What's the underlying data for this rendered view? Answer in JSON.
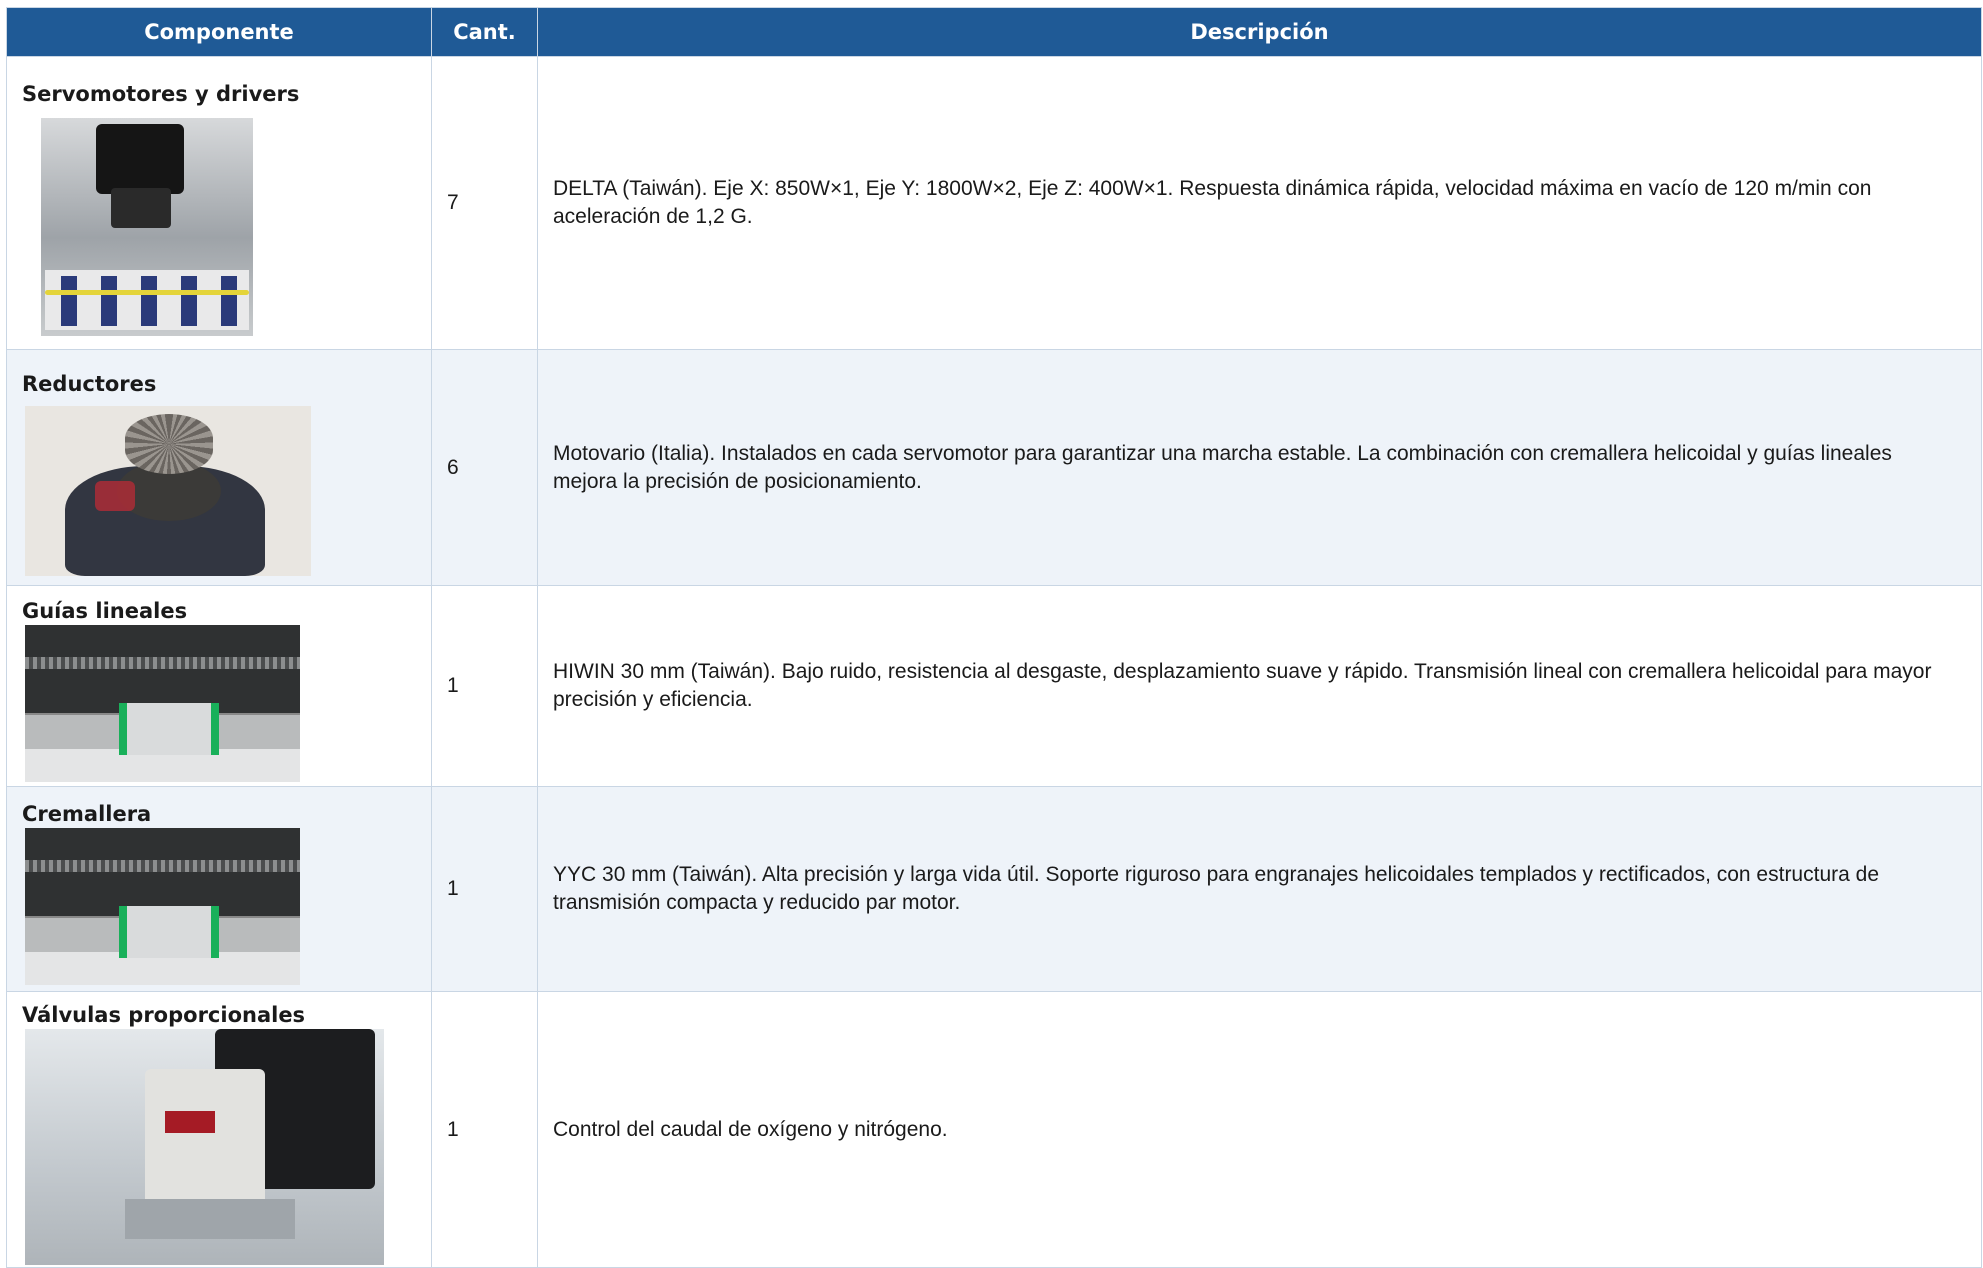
{
  "table": {
    "headers": {
      "component": "Componente",
      "quantity": "Cant.",
      "description": "Descripción"
    },
    "rows": [
      {
        "component": "Servomotores y drivers",
        "quantity": "7",
        "description": "DELTA (Taiwán). Eje X: 850W×1, Eje Y: 1800W×2, Eje Z: 400W×1. Respuesta dinámica rápida, velocidad máxima en vacío de 120 m/min con aceleración de 1,2 G.",
        "image": "servomotor-photo"
      },
      {
        "component": "Reductores",
        "quantity": "6",
        "description": "Motovario (Italia). Instalados en cada servomotor para garantizar una marcha estable. La combinación con cremallera helicoidal y guías lineales mejora la precisión de posicionamiento.",
        "image": "reducer-photo"
      },
      {
        "component": "Guías lineales",
        "quantity": "1",
        "description": "HIWIN 30 mm (Taiwán). Bajo ruido, resistencia al desgaste, desplazamiento suave y rápido. Transmisión lineal con cremallera helicoidal para mayor precisión y eficiencia.",
        "image": "linear-guide-photo"
      },
      {
        "component": "Cremallera",
        "quantity": "1",
        "description": "YYC 30 mm (Taiwán). Alta precisión y larga vida útil. Soporte riguroso para engranajes helicoidales templados y rectificados, con estructura de transmisión compacta y reducido par motor.",
        "image": "rack-photo"
      },
      {
        "component": "Válvulas proporcionales",
        "quantity": "1",
        "description": "Control del caudal de oxígeno y nitrógeno.",
        "image": "valve-photo"
      }
    ]
  },
  "colors": {
    "header_bg": "#1f5a96",
    "header_text": "#ffffff",
    "alt_row_bg": "#eef3f9",
    "border": "#c9d6e4"
  }
}
